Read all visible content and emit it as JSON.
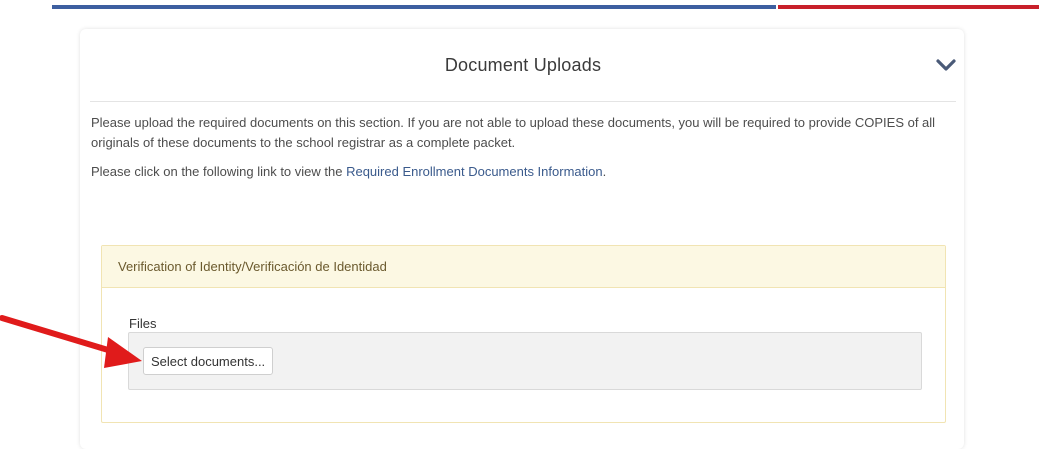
{
  "section_card": {
    "title": "Document Uploads",
    "collapse_icon": "chevron-down-icon"
  },
  "intro": {
    "paragraph1": "Please upload the required documents on this section. If you are not able to upload these documents, you will be required to provide COPIES of all originals of these documents to the school registrar as a complete packet.",
    "paragraph2_prefix": "Please click on the following link to view the ",
    "paragraph2_link": "Required Enrollment Documents Information",
    "paragraph2_suffix": "."
  },
  "identity_section": {
    "title": "Verification of Identity/Verificación de Identidad",
    "files_label": "Files",
    "select_button": "Select documents..."
  },
  "colors": {
    "top_bar_blue": "#3d5fa0",
    "top_bar_red": "#c8202a",
    "section_header_bg": "#fcf8e3",
    "link": "#3a5a8c",
    "annotation_arrow": "#e01b1b"
  },
  "annotation": {
    "icon": "red-arrow-icon"
  }
}
